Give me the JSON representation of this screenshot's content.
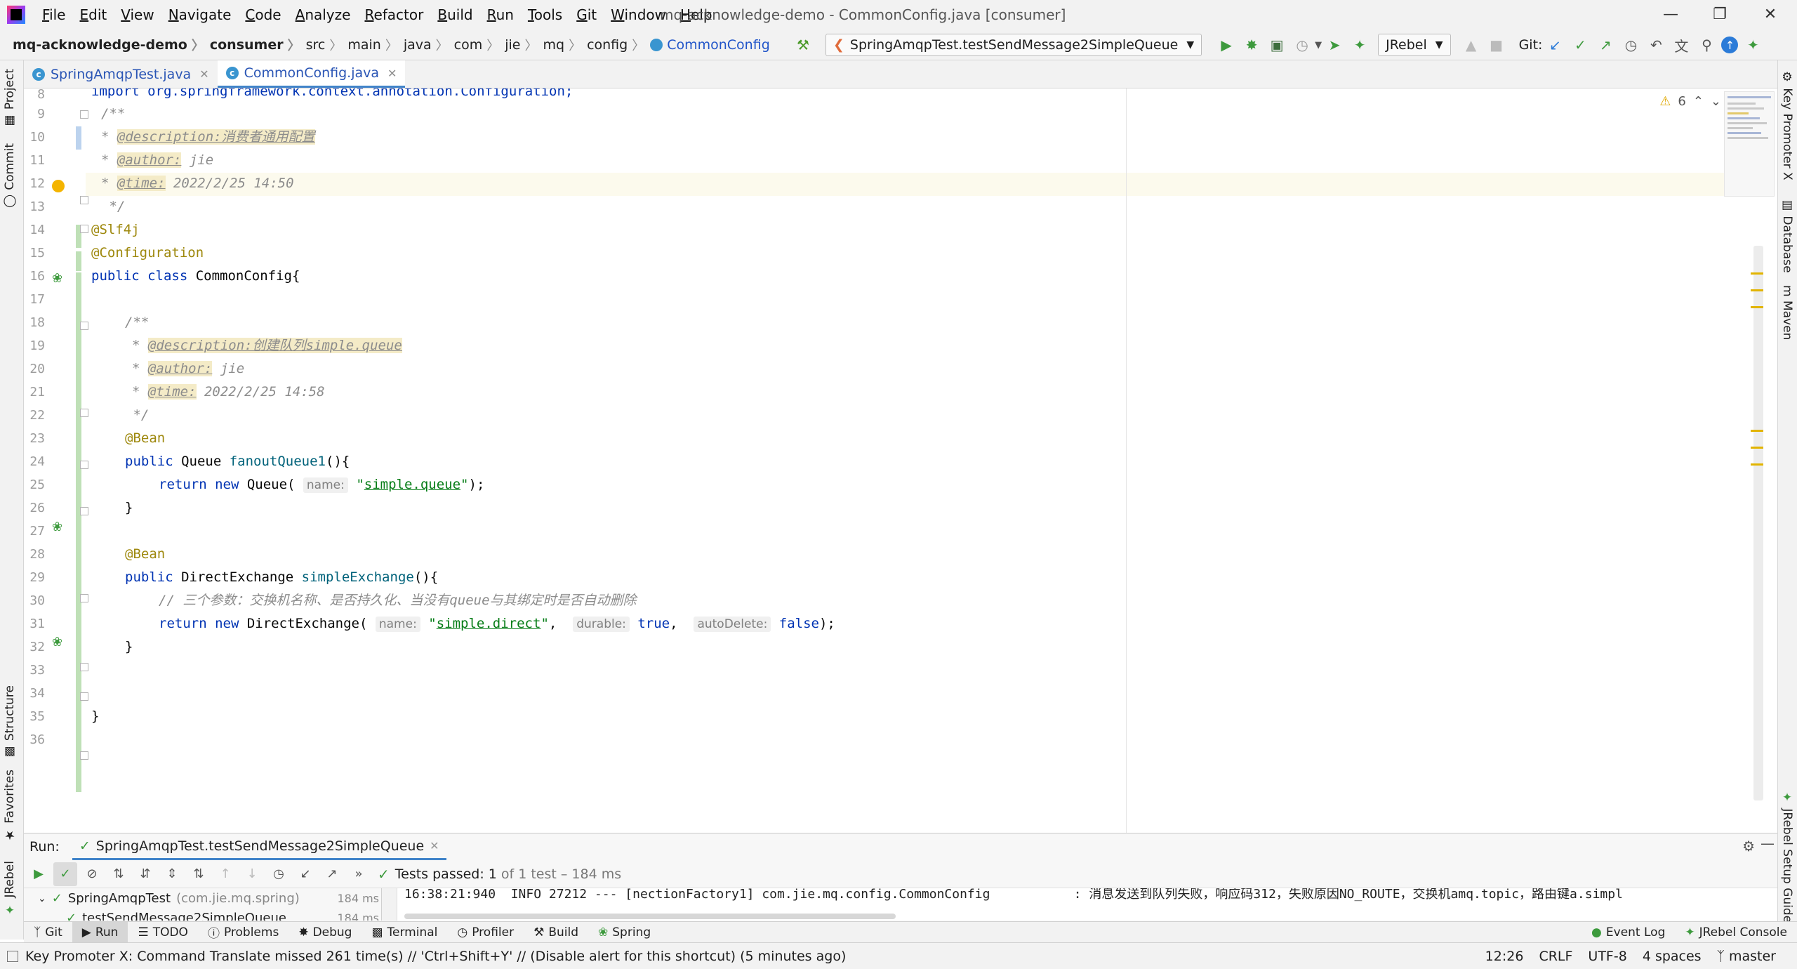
{
  "menu": {
    "items": [
      "File",
      "Edit",
      "View",
      "Navigate",
      "Code",
      "Analyze",
      "Refactor",
      "Build",
      "Run",
      "Tools",
      "Git",
      "Window",
      "Help"
    ],
    "window_title": "mq-acknowledge-demo - CommonConfig.java [consumer]"
  },
  "breadcrumb": [
    "mq-acknowledge-demo",
    "consumer",
    "src",
    "main",
    "java",
    "com",
    "jie",
    "mq",
    "config",
    "CommonConfig"
  ],
  "toolbar": {
    "run_config": "SpringAmqpTest.testSendMessage2SimpleQueue",
    "jrebel": "JRebel",
    "git_label": "Git:"
  },
  "editor_tabs": [
    {
      "label": "SpringAmqpTest.java",
      "active": false
    },
    {
      "label": "CommonConfig.java",
      "active": true
    }
  ],
  "inspection": {
    "warnings": "6"
  },
  "code": {
    "line_numbers": [
      "8",
      "9",
      "10",
      "11",
      "12",
      "13",
      "14",
      "15",
      "16",
      "17",
      "18",
      "19",
      "20",
      "21",
      "22",
      "23",
      "24",
      "25",
      "26",
      "27",
      "28",
      "29",
      "30",
      "31",
      "32",
      "33",
      "34",
      "35",
      "36"
    ],
    "l8": "import org.springframework.context.annotation.Configuration;",
    "l9": "/**",
    "l10_tag": "@description:消费者通用配置",
    "l11_tag": "@author:",
    "l11_val": " jie",
    "l12_tag": "@time:",
    "l12_val": " 2022/2/25 14:50",
    "l13": " */",
    "l14": "@Slf4j",
    "l15": "@Configuration",
    "l16_kw": "public class",
    "l16_name": " CommonConfig{",
    "l18": "/**",
    "l19_tag": "@description:创建队列simple.queue",
    "l20_tag": "@author:",
    "l20_val": " jie",
    "l21_tag": "@time:",
    "l21_val": " 2022/2/25 14:58",
    "l22": " */",
    "l23": "@Bean",
    "l24_kw": "public",
    "l24_type": " Queue ",
    "l24_fn": "fanoutQueue1",
    "l24_end": "(){",
    "l25_kw": "return new",
    "l25_type": " Queue( ",
    "l25_hint": "name:",
    "l25_str": "simple.queue",
    "l25_end": ");",
    "l26": "}",
    "l28": "@Bean",
    "l29_kw": "public",
    "l29_type": " DirectExchange ",
    "l29_fn": "simpleExchange",
    "l29_end": "(){",
    "l30": "// 三个参数：交换机名称、是否持久化、当没有queue与其绑定时是否自动删除",
    "l31_kw": "return new",
    "l31_type": " DirectExchange( ",
    "l31_hint1": "name:",
    "l31_str": "simple.direct",
    "l31_hint2": "durable:",
    "l31_val2": "true",
    "l31_hint3": "autoDelete:",
    "l31_val3": "false",
    "l31_end": ");",
    "l32": "}",
    "l35": "}"
  },
  "run_window": {
    "label": "Run:",
    "tab": "SpringAmqpTest.testSendMessage2SimpleQueue",
    "status_prefix": "Tests passed:",
    "status_count": "1",
    "status_suffix": "of 1 test – 184 ms",
    "tree": [
      {
        "label": "SpringAmqpTest",
        "pkg": "(com.jie.mq.spring)",
        "time": "184 ms"
      },
      {
        "label": "testSendMessage2SimpleQueue",
        "time": "184 ms"
      }
    ],
    "console_line": "16:38:21:940  INFO 27212 --- [nectionFactory1] com.jie.mq.config.CommonConfig           : 消息发送到队列失败，响应码312，失败原因NO_ROUTE，交换机amq.topic，路由键a.simpl"
  },
  "bottom_tabs": [
    "Git",
    "Run",
    "TODO",
    "Problems",
    "Debug",
    "Terminal",
    "Profiler",
    "Build",
    "Spring"
  ],
  "bottom_tabs_right": [
    "Event Log",
    "JRebel Console"
  ],
  "left_tabs": [
    "Project",
    "Commit",
    "Structure",
    "Favorites",
    "JRebel"
  ],
  "right_tabs": [
    "Key Promoter X",
    "Database",
    "Maven",
    "JRebel Setup Guide"
  ],
  "status": {
    "message": "Key Promoter X: Command Translate missed 261 time(s) // 'Ctrl+Shift+Y' // (Disable alert for this shortcut) (5 minutes ago)",
    "position": "12:26",
    "line_sep": "CRLF",
    "encoding": "UTF-8",
    "indent": "4 spaces",
    "branch": "master"
  },
  "colors": {
    "accent": "#4083c9",
    "keyword": "#0033b3",
    "annotation": "#9e880d",
    "string": "#067d17",
    "pass": "#3d8f3d"
  }
}
